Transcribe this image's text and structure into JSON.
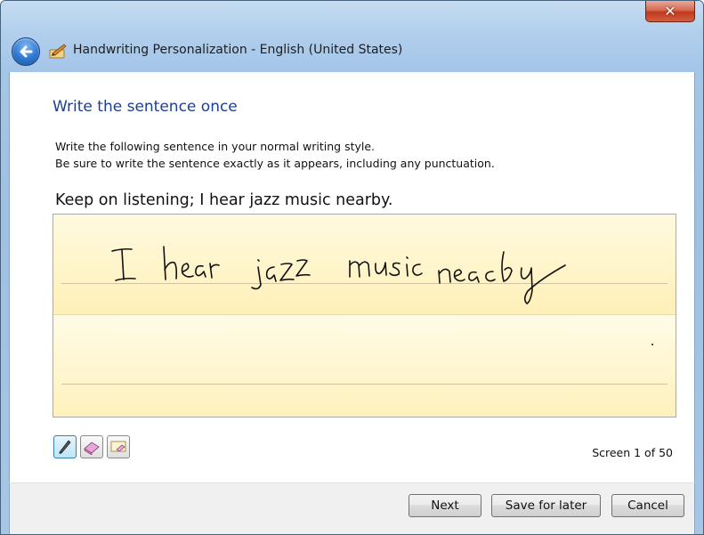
{
  "window": {
    "title": "Handwriting Personalization - English (United States)",
    "close_label": "✕"
  },
  "content": {
    "heading": "Write the sentence once",
    "instruction_line1": "Write the following sentence in your normal writing style.",
    "instruction_line2": "Be sure to write the sentence exactly as it appears, including any punctuation.",
    "sentence": "Keep on listening; I hear jazz music nearby.",
    "screen_counter": "Screen 1 of 50"
  },
  "tools": [
    {
      "name": "pen-tool-button",
      "icon": "pen-icon",
      "active": true
    },
    {
      "name": "eraser-tool-button",
      "icon": "eraser-icon",
      "active": false
    },
    {
      "name": "clear-tool-button",
      "icon": "clear-ink-icon",
      "active": false
    }
  ],
  "footer": {
    "next_label": "Next",
    "save_label": "Save for later",
    "cancel_label": "Cancel"
  },
  "colors": {
    "heading": "#1c3f94",
    "pad_fill": "#fff0b8",
    "ink": "#111111"
  }
}
